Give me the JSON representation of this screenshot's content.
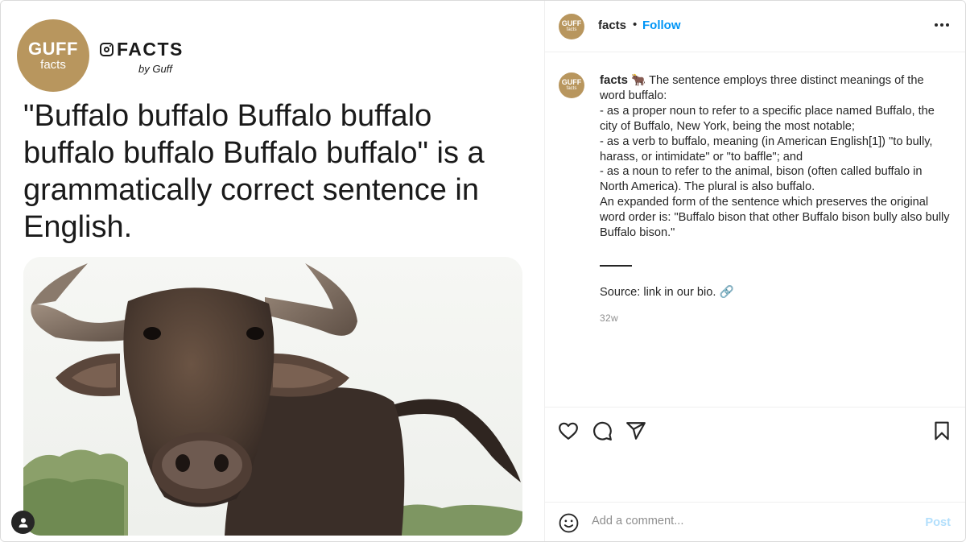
{
  "media": {
    "brand_logo": {
      "big": "GUFF",
      "small": "facts"
    },
    "brand_name": "FACTS",
    "brand_by": "by Guff",
    "headline": "\"Buffalo buffalo Buffalo buffalo buffalo buffalo Buffalo buffalo\" is a grammatically correct sentence in English.",
    "photo_icon": "water-buffalo-photo"
  },
  "header": {
    "logo": {
      "big": "GUFF",
      "small": "facts"
    },
    "username": "facts",
    "separator": "•",
    "follow_label": "Follow",
    "more_icon": "more-horizontal-icon"
  },
  "caption": {
    "username": "facts",
    "emoji": "🐂",
    "lines": [
      "The sentence employs three distinct meanings of the word buffalo:",
      "- as a proper noun to refer to a specific place named Buffalo, the city of Buffalo, New York, being the most notable;",
      "- as a verb to buffalo, meaning (in American English[1]) \"to bully, harass, or intimidate\" or \"to baffle\"; and",
      "- as a noun to refer to the animal, bison (often called buffalo in North America). The plural is also buffalo.",
      "An expanded form of the sentence which preserves the original word order is: \"Buffalo bison that other Buffalo bison bully also bully Buffalo bison.\""
    ],
    "divider": "_____",
    "source": "Source: link in our bio. 🔗",
    "time": "32w"
  },
  "actions": {
    "icons": [
      "heart-icon",
      "comment-icon",
      "share-icon",
      "bookmark-icon"
    ]
  },
  "comment": {
    "placeholder": "Add a comment...",
    "post_label": "Post",
    "emoji_icon": "emoji-icon"
  },
  "colors": {
    "brand_gold": "#b8965e",
    "link_blue": "#0095f6",
    "post_disabled": "#b2dffc"
  }
}
